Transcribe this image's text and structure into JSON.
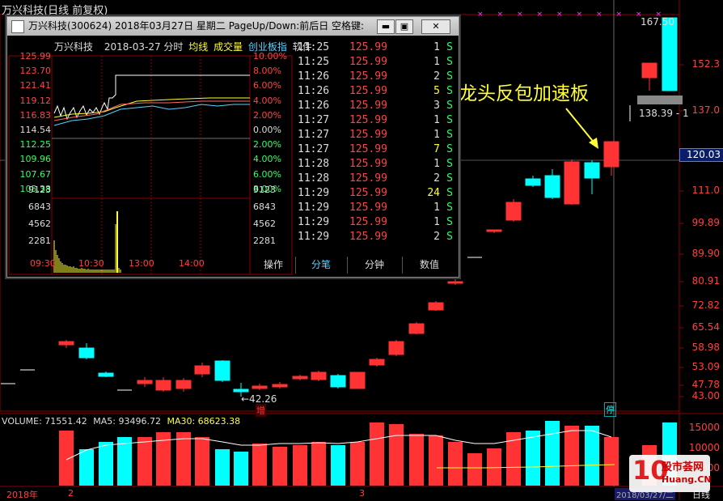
{
  "header": {
    "title": "万兴科技(日线 前复权)"
  },
  "price_axis": [
    "167.50",
    "152.3",
    "137.0",
    "111.0",
    "99.89",
    "89.90",
    "80.91",
    "72.82",
    "65.54",
    "58.98",
    "53.09",
    "47.78",
    "43.00"
  ],
  "current_price": "120.03",
  "max_label": "167.50",
  "range_label": "138.39 - 1",
  "low_label": "←42.26",
  "zeng_label": "增",
  "ting_label": "停",
  "volume": {
    "label_volume": "VOLUME: 71551.42",
    "label_ma5": "MA5: 93496.72",
    "label_ma30": "MA30: 68623.38",
    "axis": [
      "15000",
      "10000",
      "5000",
      "X100"
    ]
  },
  "bottom_axis": {
    "year": "2018年",
    "m2": "2",
    "m3": "3",
    "date": "2018/03/27/二",
    "period": "日线"
  },
  "annotation": "龙头反包加速板",
  "watermark": {
    "brand": "股市荟网",
    "url": "Huang.CN",
    "num": "10"
  },
  "colors": {
    "up": "#ff3333",
    "down": "#00ffff",
    "ma": "#ffff33",
    "bg": "#000000"
  },
  "popup": {
    "title": "万兴科技(300624) 2018年03月27日 星期二 PageUp/Down:前后日 空格键:",
    "close": "✕",
    "subheader": {
      "name": "万兴科技",
      "date": "2018-03-27 分时",
      "ma": "均线",
      "volume": "成交量",
      "index": "创业板指",
      "soft": "软件"
    },
    "price_axis": [
      "125.99",
      "123.70",
      "121.41",
      "119.12",
      "116.83",
      "114.54",
      "112.25",
      "109.96",
      "107.67",
      "105.38"
    ],
    "pct_axis": [
      "10.00%",
      "8.00%",
      "6.00%",
      "4.00%",
      "2.00%",
      "0.00%",
      "2.00%",
      "4.00%",
      "6.00%",
      "8.00%"
    ],
    "vol_axis": [
      "9123",
      "6843",
      "4562",
      "2281"
    ],
    "time_axis": [
      "09:30",
      "10:30",
      "13:00",
      "14:00"
    ],
    "trades": [
      {
        "t": "11:25",
        "p": "125.99",
        "v": "1",
        "s": "S"
      },
      {
        "t": "11:25",
        "p": "125.99",
        "v": "1",
        "s": "S"
      },
      {
        "t": "11:26",
        "p": "125.99",
        "v": "2",
        "s": "S"
      },
      {
        "t": "11:26",
        "p": "125.99",
        "v": "5",
        "s": "S"
      },
      {
        "t": "11:26",
        "p": "125.99",
        "v": "3",
        "s": "S"
      },
      {
        "t": "11:27",
        "p": "125.99",
        "v": "1",
        "s": "S"
      },
      {
        "t": "11:27",
        "p": "125.99",
        "v": "1",
        "s": "S"
      },
      {
        "t": "11:27",
        "p": "125.99",
        "v": "7",
        "s": "S"
      },
      {
        "t": "11:28",
        "p": "125.99",
        "v": "1",
        "s": "S"
      },
      {
        "t": "11:28",
        "p": "125.99",
        "v": "2",
        "s": "S"
      },
      {
        "t": "11:29",
        "p": "125.99",
        "v": "24",
        "s": "S"
      },
      {
        "t": "11:29",
        "p": "125.99",
        "v": "1",
        "s": "S"
      },
      {
        "t": "11:29",
        "p": "125.99",
        "v": "1",
        "s": "S"
      },
      {
        "t": "11:29",
        "p": "125.99",
        "v": "2",
        "s": "S"
      }
    ],
    "tabs": [
      "操作",
      "分笔",
      "分钟",
      "数值"
    ]
  }
}
